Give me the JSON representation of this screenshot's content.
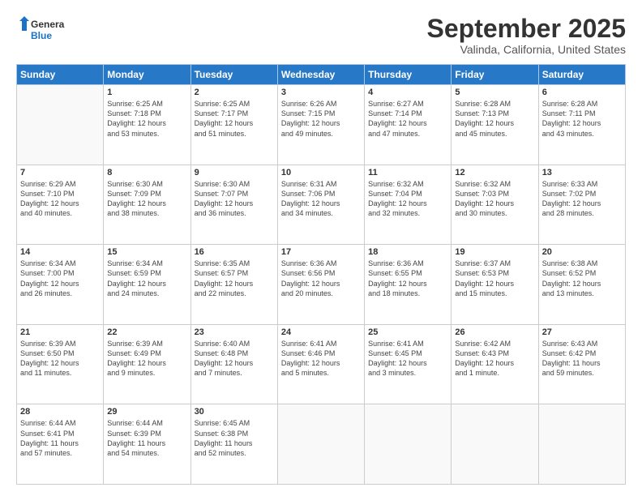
{
  "header": {
    "logo_general": "General",
    "logo_blue": "Blue",
    "month": "September 2025",
    "location": "Valinda, California, United States"
  },
  "days_of_week": [
    "Sunday",
    "Monday",
    "Tuesday",
    "Wednesday",
    "Thursday",
    "Friday",
    "Saturday"
  ],
  "weeks": [
    [
      {
        "day": "",
        "info": ""
      },
      {
        "day": "1",
        "info": "Sunrise: 6:25 AM\nSunset: 7:18 PM\nDaylight: 12 hours\nand 53 minutes."
      },
      {
        "day": "2",
        "info": "Sunrise: 6:25 AM\nSunset: 7:17 PM\nDaylight: 12 hours\nand 51 minutes."
      },
      {
        "day": "3",
        "info": "Sunrise: 6:26 AM\nSunset: 7:15 PM\nDaylight: 12 hours\nand 49 minutes."
      },
      {
        "day": "4",
        "info": "Sunrise: 6:27 AM\nSunset: 7:14 PM\nDaylight: 12 hours\nand 47 minutes."
      },
      {
        "day": "5",
        "info": "Sunrise: 6:28 AM\nSunset: 7:13 PM\nDaylight: 12 hours\nand 45 minutes."
      },
      {
        "day": "6",
        "info": "Sunrise: 6:28 AM\nSunset: 7:11 PM\nDaylight: 12 hours\nand 43 minutes."
      }
    ],
    [
      {
        "day": "7",
        "info": "Sunrise: 6:29 AM\nSunset: 7:10 PM\nDaylight: 12 hours\nand 40 minutes."
      },
      {
        "day": "8",
        "info": "Sunrise: 6:30 AM\nSunset: 7:09 PM\nDaylight: 12 hours\nand 38 minutes."
      },
      {
        "day": "9",
        "info": "Sunrise: 6:30 AM\nSunset: 7:07 PM\nDaylight: 12 hours\nand 36 minutes."
      },
      {
        "day": "10",
        "info": "Sunrise: 6:31 AM\nSunset: 7:06 PM\nDaylight: 12 hours\nand 34 minutes."
      },
      {
        "day": "11",
        "info": "Sunrise: 6:32 AM\nSunset: 7:04 PM\nDaylight: 12 hours\nand 32 minutes."
      },
      {
        "day": "12",
        "info": "Sunrise: 6:32 AM\nSunset: 7:03 PM\nDaylight: 12 hours\nand 30 minutes."
      },
      {
        "day": "13",
        "info": "Sunrise: 6:33 AM\nSunset: 7:02 PM\nDaylight: 12 hours\nand 28 minutes."
      }
    ],
    [
      {
        "day": "14",
        "info": "Sunrise: 6:34 AM\nSunset: 7:00 PM\nDaylight: 12 hours\nand 26 minutes."
      },
      {
        "day": "15",
        "info": "Sunrise: 6:34 AM\nSunset: 6:59 PM\nDaylight: 12 hours\nand 24 minutes."
      },
      {
        "day": "16",
        "info": "Sunrise: 6:35 AM\nSunset: 6:57 PM\nDaylight: 12 hours\nand 22 minutes."
      },
      {
        "day": "17",
        "info": "Sunrise: 6:36 AM\nSunset: 6:56 PM\nDaylight: 12 hours\nand 20 minutes."
      },
      {
        "day": "18",
        "info": "Sunrise: 6:36 AM\nSunset: 6:55 PM\nDaylight: 12 hours\nand 18 minutes."
      },
      {
        "day": "19",
        "info": "Sunrise: 6:37 AM\nSunset: 6:53 PM\nDaylight: 12 hours\nand 15 minutes."
      },
      {
        "day": "20",
        "info": "Sunrise: 6:38 AM\nSunset: 6:52 PM\nDaylight: 12 hours\nand 13 minutes."
      }
    ],
    [
      {
        "day": "21",
        "info": "Sunrise: 6:39 AM\nSunset: 6:50 PM\nDaylight: 12 hours\nand 11 minutes."
      },
      {
        "day": "22",
        "info": "Sunrise: 6:39 AM\nSunset: 6:49 PM\nDaylight: 12 hours\nand 9 minutes."
      },
      {
        "day": "23",
        "info": "Sunrise: 6:40 AM\nSunset: 6:48 PM\nDaylight: 12 hours\nand 7 minutes."
      },
      {
        "day": "24",
        "info": "Sunrise: 6:41 AM\nSunset: 6:46 PM\nDaylight: 12 hours\nand 5 minutes."
      },
      {
        "day": "25",
        "info": "Sunrise: 6:41 AM\nSunset: 6:45 PM\nDaylight: 12 hours\nand 3 minutes."
      },
      {
        "day": "26",
        "info": "Sunrise: 6:42 AM\nSunset: 6:43 PM\nDaylight: 12 hours\nand 1 minute."
      },
      {
        "day": "27",
        "info": "Sunrise: 6:43 AM\nSunset: 6:42 PM\nDaylight: 11 hours\nand 59 minutes."
      }
    ],
    [
      {
        "day": "28",
        "info": "Sunrise: 6:44 AM\nSunset: 6:41 PM\nDaylight: 11 hours\nand 57 minutes."
      },
      {
        "day": "29",
        "info": "Sunrise: 6:44 AM\nSunset: 6:39 PM\nDaylight: 11 hours\nand 54 minutes."
      },
      {
        "day": "30",
        "info": "Sunrise: 6:45 AM\nSunset: 6:38 PM\nDaylight: 11 hours\nand 52 minutes."
      },
      {
        "day": "",
        "info": ""
      },
      {
        "day": "",
        "info": ""
      },
      {
        "day": "",
        "info": ""
      },
      {
        "day": "",
        "info": ""
      }
    ]
  ]
}
